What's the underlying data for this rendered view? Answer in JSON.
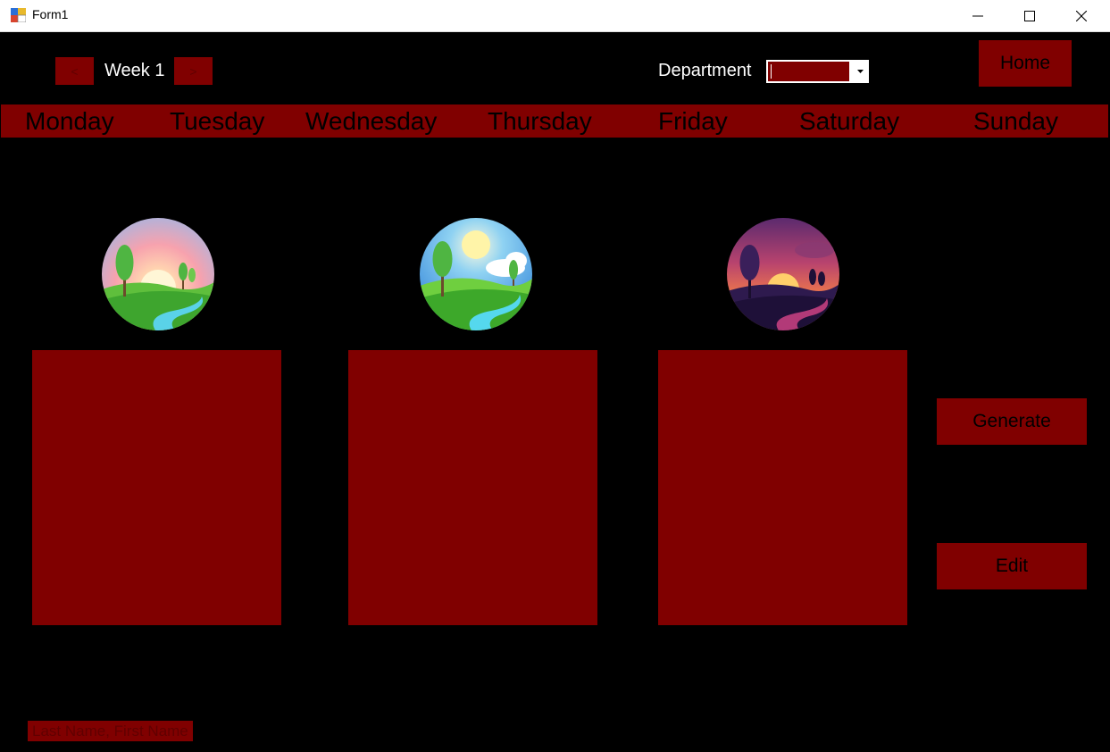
{
  "window": {
    "title": "Form1",
    "minimize_icon": "minimize-icon",
    "maximize_icon": "maximize-icon",
    "close_icon": "close-icon"
  },
  "nav": {
    "prev_label": "<",
    "next_label": ">",
    "week_label": "Week 1"
  },
  "department": {
    "label": "Department",
    "value": ""
  },
  "home_label": "Home",
  "days": [
    "Monday",
    "Tuesday",
    "Wednesday",
    "Thursday",
    "Friday",
    "Saturday",
    "Sunday"
  ],
  "shifts": [
    {
      "icon": "sunrise-landscape-icon"
    },
    {
      "icon": "day-landscape-icon"
    },
    {
      "icon": "sunset-landscape-icon"
    }
  ],
  "actions": {
    "generate_label": "Generate",
    "edit_label": "Edit"
  },
  "employee_label": "Last Name, First Name",
  "colors": {
    "background": "#000000",
    "accent": "#800000",
    "text": "#ffffff"
  }
}
